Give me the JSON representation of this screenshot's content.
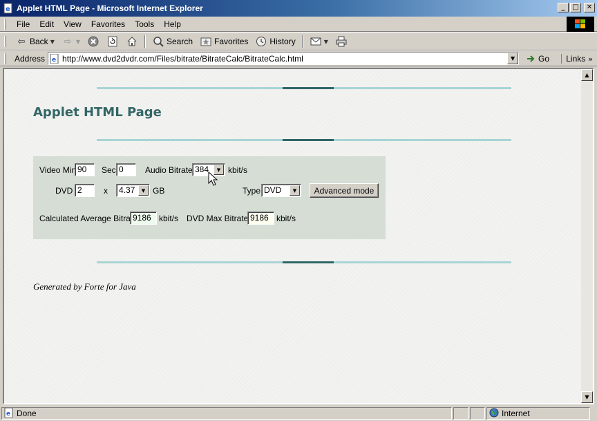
{
  "window": {
    "title": "Applet HTML Page - Microsoft Internet Explorer"
  },
  "menubar": {
    "items": [
      {
        "key": "F",
        "rest": "ile"
      },
      {
        "key": "E",
        "rest": "dit"
      },
      {
        "key": "V",
        "rest": "iew"
      },
      {
        "key": "F",
        "rest": "a",
        "pre": "",
        "full": "Favorites",
        "underline_index": 0
      },
      {
        "key": "T",
        "rest": "ools"
      },
      {
        "key": "H",
        "rest": "elp"
      }
    ],
    "labels": [
      "File",
      "Edit",
      "View",
      "Favorites",
      "Tools",
      "Help"
    ]
  },
  "toolbar": {
    "back": "Back",
    "search": "Search",
    "favorites": "Favorites",
    "history": "History"
  },
  "address": {
    "label": "Address",
    "url": "http://www.dvd2dvdr.com/Files/bitrate/BitrateCalc/BitrateCalc.html",
    "go": "Go",
    "links": "Links"
  },
  "page": {
    "title": "Applet HTML Page",
    "footer": "Generated by Forte for Java"
  },
  "applet": {
    "video_min_label": "Video Min",
    "video_min_value": "90",
    "sec_label": "Sec",
    "sec_value": "0",
    "audio_bitrate_label": "Audio Bitrate",
    "audio_bitrate_value": "384",
    "audio_unit": "kbit/s",
    "dvd_label": "DVD",
    "dvd_value": "2",
    "times": "x",
    "size_value": "4.37",
    "size_unit": "GB",
    "type_label": "Type",
    "type_value": "DVD",
    "advanced_button": "Advanced mode",
    "avg_bitrate_label": "Calculated Average Bitrate",
    "avg_bitrate_value": "9186",
    "avg_unit": "kbit/s",
    "max_bitrate_label": "DVD Max Bitrate",
    "max_bitrate_value": "9186",
    "max_unit": "kbit/s"
  },
  "status": {
    "text": "Done",
    "zone": "Internet"
  }
}
